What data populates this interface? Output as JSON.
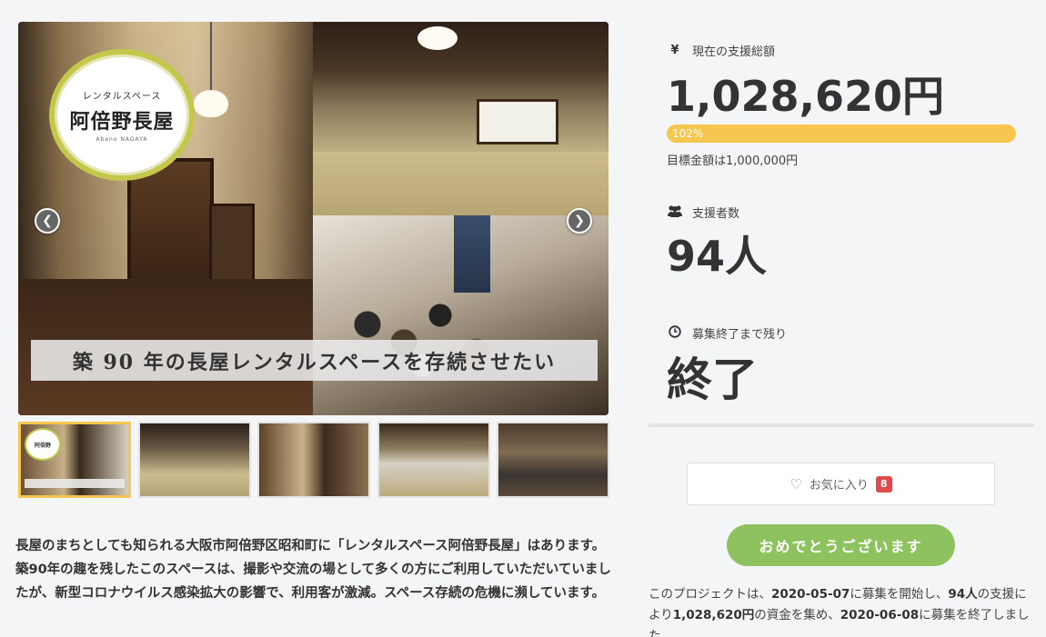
{
  "hero": {
    "logo_top": "レンタルスペース",
    "logo_main": "阿倍野長屋",
    "logo_sub": "Abeno NAGAYA",
    "caption": "築 90 年の長屋レンタルスペースを存続させたい",
    "prev_icon": "chevron-left-icon",
    "next_icon": "chevron-right-icon"
  },
  "thumbnails": [
    {
      "active": true
    },
    {
      "active": false
    },
    {
      "active": false
    },
    {
      "active": false
    },
    {
      "active": false
    }
  ],
  "description": "長屋のまちとしても知られる大阪市阿倍野区昭和町に「レンタルスペース阿倍野長屋」はあります。築90年の趣を残したこのスペースは、撮影や交流の場として多くの方にご利用していただいていましたが、新型コロナウイルス感染拡大の影響で、利用客が激減。スペース存続の危機に瀕しています。",
  "stats": {
    "total_label": "現在の支援総額",
    "total_icon": "¥",
    "total_value": "1,028,620円",
    "progress_percent": 102,
    "progress_label": "102%",
    "goal_text": "目標金額は1,000,000円",
    "supporters_label": "支援者数",
    "supporters_icon": "users-icon",
    "supporters_value": "94人",
    "remaining_label": "募集終了まで残り",
    "remaining_icon": "clock-icon",
    "remaining_value": "終了"
  },
  "favorite": {
    "label": "お気に入り",
    "count": "8"
  },
  "congrats_button": "おめでとうございます",
  "summary": {
    "p1": "このプロジェクトは、",
    "start_date": "2020-05-07",
    "p2": "に募集を開始し、",
    "supporters": "94人",
    "p3": "の支援に",
    "p4": "より",
    "amount": "1,028,620円",
    "p5": "の資金を集め、",
    "end_date": "2020-06-08",
    "p6": "に募集を終了しました"
  },
  "colors": {
    "accent_yellow": "#f6c64f",
    "accent_green": "#8dc25f",
    "badge_red": "#e04a4a"
  }
}
